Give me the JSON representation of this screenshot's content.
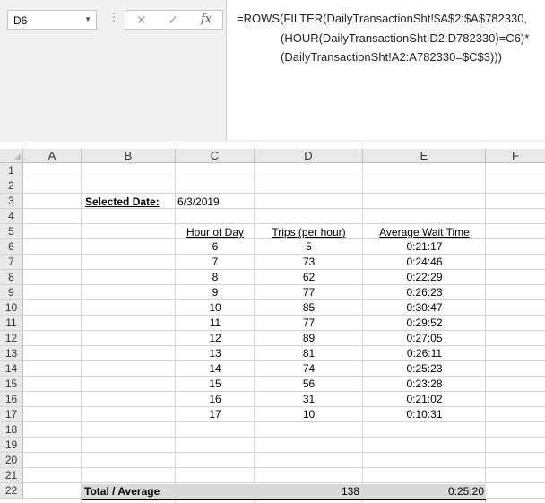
{
  "formula_bar": {
    "name_box": "D6",
    "cancel_icon": "✕",
    "enter_icon": "✓",
    "fx_label": "fx",
    "formula_lines": [
      "=ROWS(FILTER(DailyTransactionSht!$A$2:$A$782330,",
      "(HOUR(DailyTransactionSht!D2:D782330)=C6)*",
      "(DailyTransactionSht!A2:A782330=$C$3)))"
    ]
  },
  "columns": [
    "A",
    "B",
    "C",
    "D",
    "E",
    "F"
  ],
  "rows": [
    "1",
    "2",
    "3",
    "4",
    "5",
    "6",
    "7",
    "8",
    "9",
    "10",
    "11",
    "12",
    "13",
    "14",
    "15",
    "16",
    "17",
    "18",
    "19",
    "20",
    "21",
    "22"
  ],
  "selected": {
    "label": "Selected Date:",
    "value": "6/3/2019"
  },
  "table": {
    "headers": [
      "Hour of Day",
      "Trips (per hour)",
      "Average Wait Time"
    ],
    "rows": [
      [
        "6",
        "5",
        "0:21:17"
      ],
      [
        "7",
        "73",
        "0:24:46"
      ],
      [
        "8",
        "62",
        "0:22:29"
      ],
      [
        "9",
        "77",
        "0:26:23"
      ],
      [
        "10",
        "85",
        "0:30:47"
      ],
      [
        "11",
        "77",
        "0:29:52"
      ],
      [
        "12",
        "89",
        "0:27:05"
      ],
      [
        "13",
        "81",
        "0:26:11"
      ],
      [
        "14",
        "74",
        "0:25:23"
      ],
      [
        "15",
        "56",
        "0:23:28"
      ],
      [
        "16",
        "31",
        "0:21:02"
      ],
      [
        "17",
        "10",
        "0:10:31"
      ]
    ],
    "total_label": "Total / Average",
    "total_trips": "138",
    "total_wait": "0:25:20"
  }
}
